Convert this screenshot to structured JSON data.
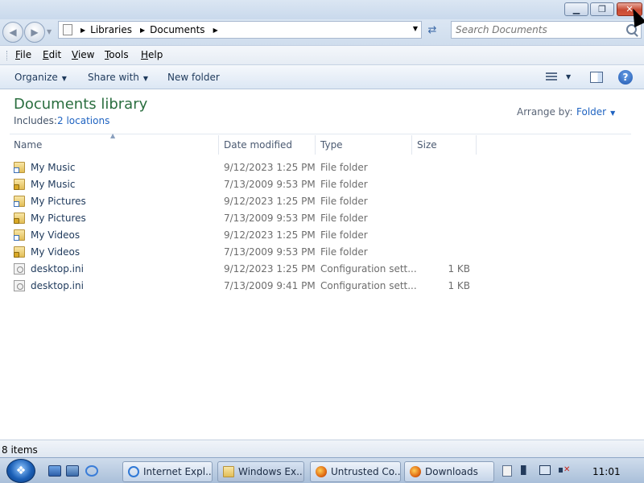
{
  "window": {
    "caption_buttons": {
      "minimize": "▁",
      "maximize": "❐",
      "close": "✕"
    }
  },
  "navigation": {
    "back_glyph": "◀",
    "forward_glyph": "▶",
    "address": {
      "crumbs": [
        "Libraries",
        "Documents"
      ]
    },
    "search": {
      "placeholder": "Search Documents"
    }
  },
  "menu": {
    "items": [
      {
        "label": "File",
        "accel": "F",
        "rest": "ile"
      },
      {
        "label": "Edit",
        "accel": "E",
        "rest": "dit"
      },
      {
        "label": "View",
        "accel": "V",
        "rest": "iew"
      },
      {
        "label": "Tools",
        "accel": "T",
        "rest": "ools"
      },
      {
        "label": "Help",
        "accel": "H",
        "rest": "elp"
      }
    ]
  },
  "commands": {
    "organize": "Organize",
    "share_with": "Share with",
    "new_folder": "New folder",
    "help_glyph": "?"
  },
  "library": {
    "title": "Documents library",
    "includes_label": "Includes:",
    "locations": "2 locations",
    "arrange_label": "Arrange by:",
    "arrange_value": "Folder"
  },
  "columns": {
    "name": "Name",
    "date": "Date modified",
    "type": "Type",
    "size": "Size"
  },
  "files": [
    {
      "name": "My Music",
      "date": "9/12/2023 1:25 PM",
      "type": "File folder",
      "size": "",
      "icon": "folder-shortcut-icon"
    },
    {
      "name": "My Music",
      "date": "7/13/2009 9:53 PM",
      "type": "File folder",
      "size": "",
      "icon": "folder-lock-icon"
    },
    {
      "name": "My Pictures",
      "date": "9/12/2023 1:25 PM",
      "type": "File folder",
      "size": "",
      "icon": "folder-shortcut-icon"
    },
    {
      "name": "My Pictures",
      "date": "7/13/2009 9:53 PM",
      "type": "File folder",
      "size": "",
      "icon": "folder-lock-icon"
    },
    {
      "name": "My Videos",
      "date": "9/12/2023 1:25 PM",
      "type": "File folder",
      "size": "",
      "icon": "folder-shortcut-icon"
    },
    {
      "name": "My Videos",
      "date": "7/13/2009 9:53 PM",
      "type": "File folder",
      "size": "",
      "icon": "folder-lock-icon"
    },
    {
      "name": "desktop.ini",
      "date": "9/12/2023 1:25 PM",
      "type": "Configuration sett...",
      "size": "1 KB",
      "icon": "settings-file-icon"
    },
    {
      "name": "desktop.ini",
      "date": "7/13/2009 9:41 PM",
      "type": "Configuration sett...",
      "size": "1 KB",
      "icon": "settings-file-icon"
    }
  ],
  "status": {
    "item_count": "8 items"
  },
  "taskbar": {
    "start_glyph": "❖",
    "tasks": [
      {
        "label": "Internet Expl...",
        "icon": "internet-explorer-icon"
      },
      {
        "label": "Windows Ex...",
        "icon": "folder-icon"
      },
      {
        "label": "Untrusted Co...",
        "icon": "firefox-icon"
      },
      {
        "label": "Downloads",
        "icon": "firefox-icon"
      }
    ],
    "clock": "11:01"
  },
  "colors": {
    "title_green": "#2a6e3f",
    "link_blue": "#1f63c1",
    "close_red": "#c74a33"
  }
}
